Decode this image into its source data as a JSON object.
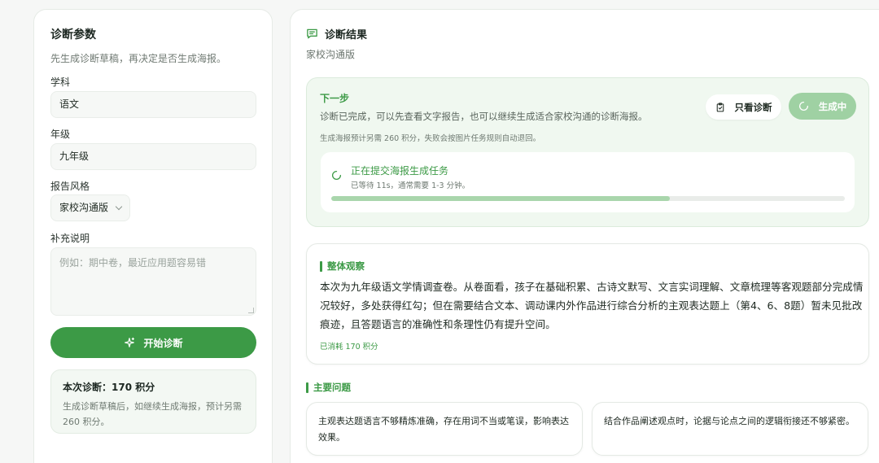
{
  "params": {
    "title": "诊断参数",
    "subtitle": "先生成诊断草稿，再决定是否生成海报。",
    "subject_label": "学科",
    "subject_value": "语文",
    "grade_label": "年级",
    "grade_value": "九年级",
    "style_label": "报告风格",
    "style_value": "家校沟通版",
    "note_label": "补充说明",
    "note_placeholder": "例如：期中卷，最近应用题容易错",
    "start_button": "开始诊断",
    "cost_title": "本次诊断：170 积分",
    "cost_desc": "生成诊断草稿后，如继续生成海报，预计另需 260 积分。"
  },
  "result": {
    "title": "诊断结果",
    "subtitle": "家校沟通版",
    "next_step": {
      "title": "下一步",
      "desc": "诊断已完成，可以先查看文字报告，也可以继续生成适合家校沟通的诊断海报。",
      "hint": "生成海报预计另需 260 积分，失败会按图片任务规则自动退回。",
      "view_button": "只看诊断",
      "generate_button": "生成中",
      "progress_title": "正在提交海报生成任务",
      "progress_sub": "已等待 11s，通常需要 1-3 分钟。",
      "progress_fraction": 0.66
    },
    "observation": {
      "title": "整体观察",
      "body": "本次为九年级语文学情调查卷。从卷面看，孩子在基础积累、古诗文默写、文言实词理解、文章梳理等客观题部分完成情况较好，多处获得红勾；但在需要结合文本、调动课内外作品进行综合分析的主观表达题上（第4、6、8题）暂未见批改痕迹，且答题语言的准确性和条理性仍有提升空间。",
      "cost": "已消耗 170 积分"
    },
    "issues_title": "主要问题",
    "issues": [
      "主观表达题语言不够精炼准确，存在用词不当或笔误，影响表达效果。",
      "结合作品阐述观点时，论据与论点之间的逻辑衔接还不够紧密。"
    ]
  },
  "colors": {
    "accent": "#3c9a46",
    "accent_light": "#9fd1a3",
    "card_tint": "#f0f8f0"
  },
  "icons": {
    "result_header": "message-square-icon",
    "start": "sparkle-icon",
    "view": "clipboard-check-icon",
    "generating": "spinner-icon"
  }
}
